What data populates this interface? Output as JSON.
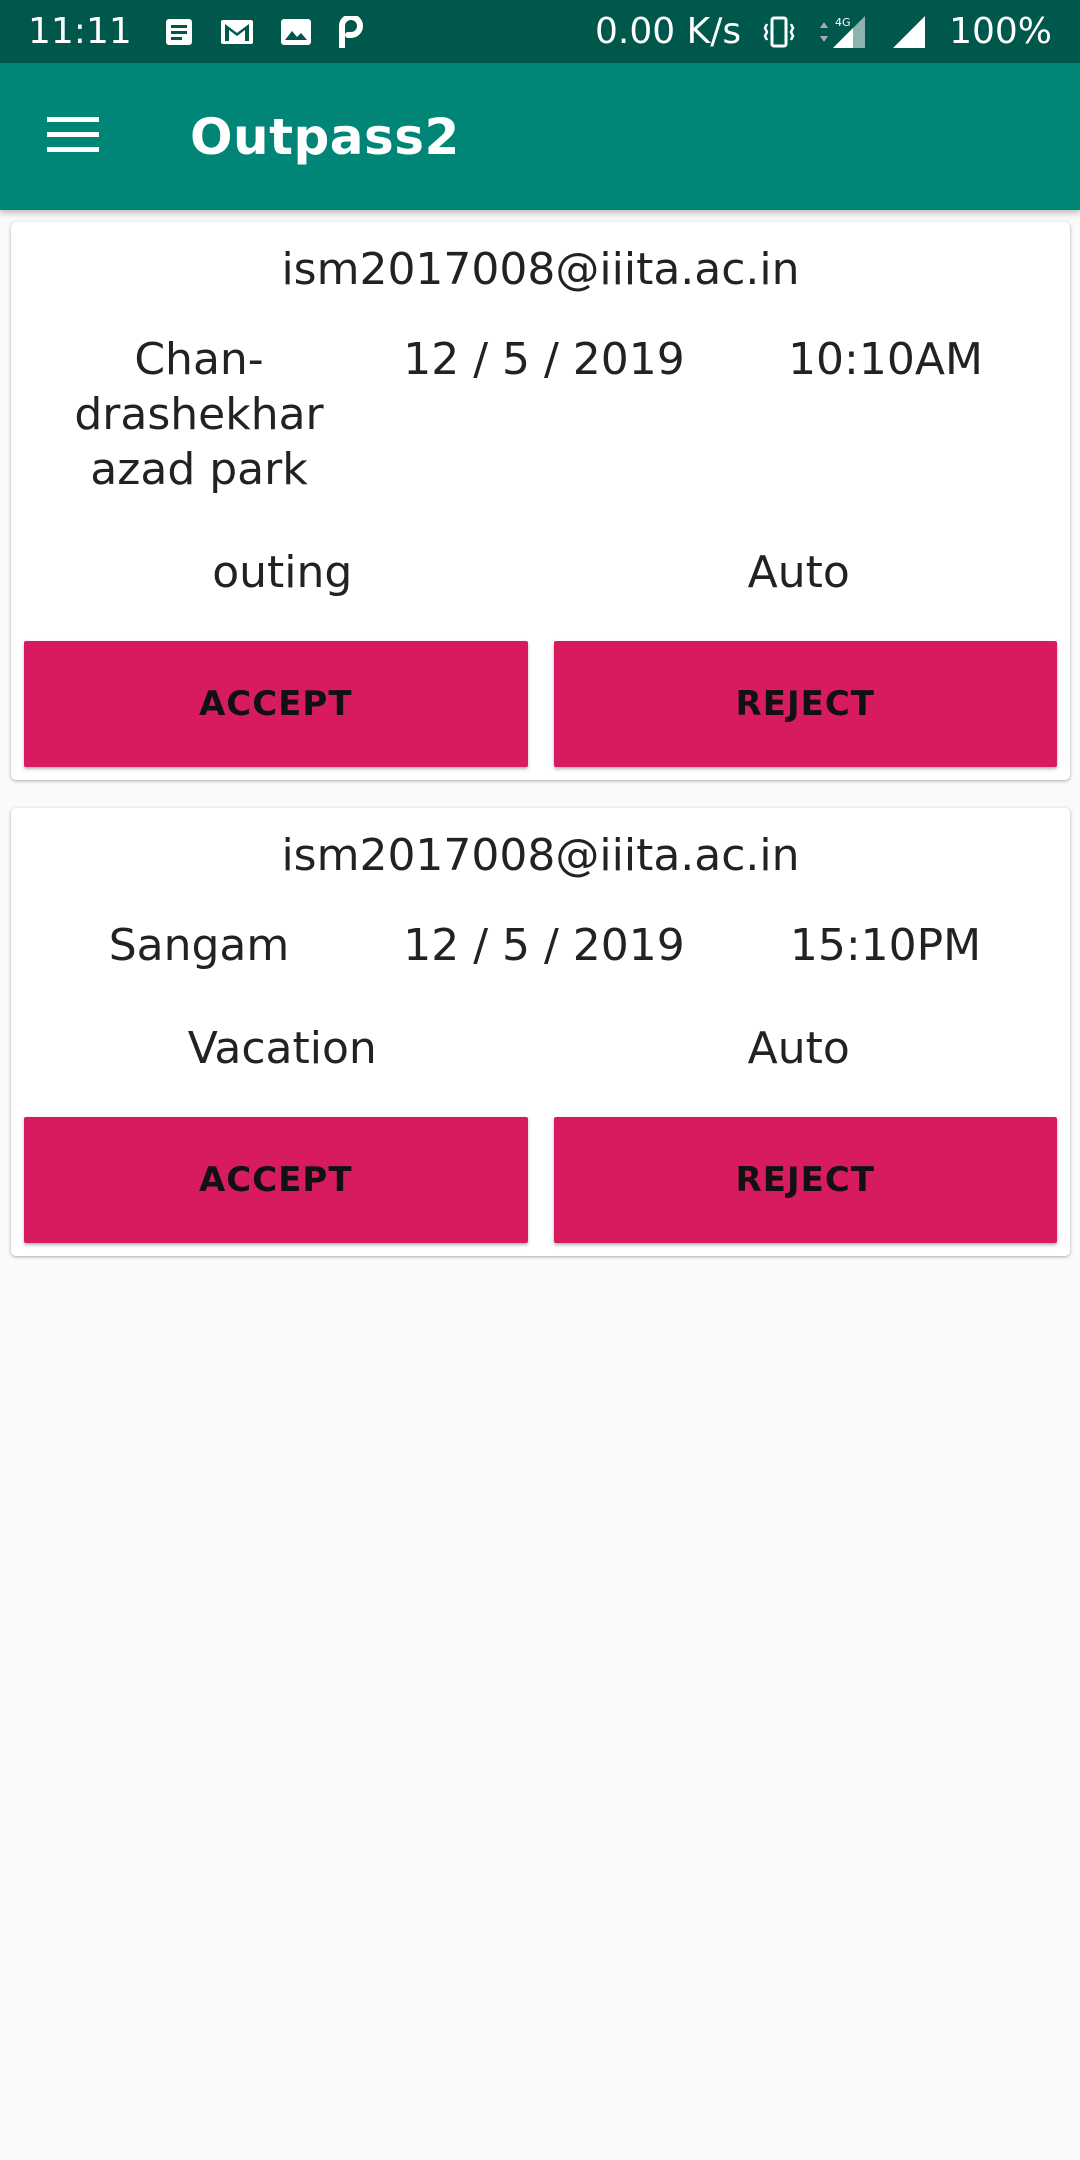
{
  "status_bar": {
    "time": "11:11",
    "network_speed": "0.00 K/s",
    "network_type": "4G",
    "battery": "100%",
    "icons": [
      "notes-icon",
      "gmail-icon",
      "image-icon",
      "paytm-icon",
      "vibrate-icon",
      "signal-4g-icon",
      "signal-icon"
    ]
  },
  "app_bar": {
    "title": "Outpass2",
    "menu_icon": "hamburger-menu-icon",
    "color": "#008577"
  },
  "colors": {
    "status_bar": "#00574b",
    "accent": "#d81b60",
    "background": "#fafafa"
  },
  "requests": [
    {
      "email": "ism2017008@iiita.ac.in",
      "place": "Chan-\ndrashekhar\nazad park",
      "date": "12 / 5 / 2019",
      "time": "10:10AM",
      "purpose": "outing",
      "mode": "Auto",
      "accept_label": "ACCEPT",
      "reject_label": "REJECT"
    },
    {
      "email": "ism2017008@iiita.ac.in",
      "place": "Sangam",
      "date": "12 / 5 / 2019",
      "time": "15:10PM",
      "purpose": "Vacation",
      "mode": "Auto",
      "accept_label": "ACCEPT",
      "reject_label": "REJECT"
    }
  ]
}
